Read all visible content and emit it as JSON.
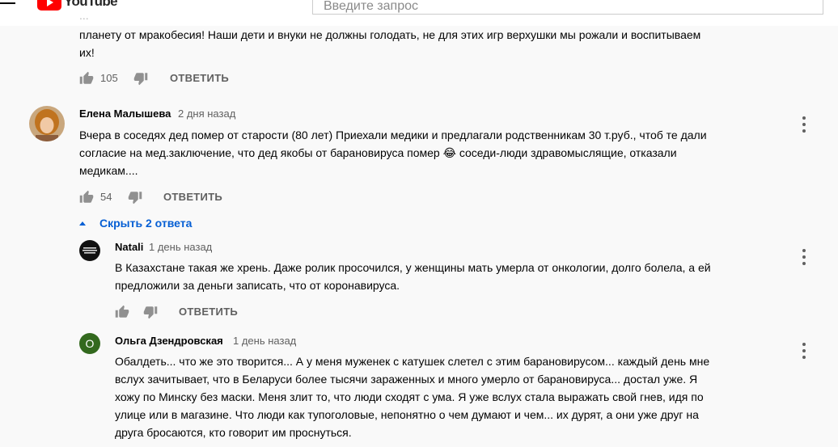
{
  "masthead": {
    "logo_text": "YouTube",
    "search_placeholder": "Введите запрос"
  },
  "colors": {
    "accent": "#065fd4",
    "secondary_text": "#606060",
    "logo_red": "#ff0000",
    "letter_avatar_bg": "#33691e"
  },
  "top_comment": {
    "hidden_line": "...",
    "text_lines": [
      "планету от мракобесия!  Наши дети и внуки не должны голодать, не для этих игр верхушки мы рожали и воспитываем",
      "их!"
    ],
    "like_count": "105",
    "reply_label": "ОТВЕТИТЬ"
  },
  "comment": {
    "author": "Елена Малышева",
    "date": "2 дня назад",
    "text_lines": [
      "Вчера в соседях дед помер от старости (80 лет) Приехали медики и предлагали родственникам 30 т.руб., чтоб те  дали",
      "согласие на мед.заключение, что дед якобы от барановируса помер 😂 соседи-люди здравомыслящие, отказали",
      "медикам...."
    ],
    "like_count": "54",
    "reply_label": "ОТВЕТИТЬ",
    "hide_replies_label": "Скрыть 2 ответа"
  },
  "replies": [
    {
      "author": "Natali",
      "date": "1 день назад",
      "text_lines": [
        "В Казахстане такая же хрень. Даже ролик просочился, у женщины мать умерла от онкологии, долго болела, а ей",
        "предложили за деньги записать, что от коронавируса."
      ],
      "reply_label": "ОТВЕТИТЬ"
    },
    {
      "author": "Ольга Дзендровская",
      "date": "1 день назад",
      "avatar_letter": "О",
      "text_lines": [
        "Обалдеть... что же это творится... А у меня муженек с катушек слетел с этим барановирусом... каждый день мне",
        "вслух зачитывает, что в Беларуси более тысячи зараженных и много умерло от барановируса... достал уже. Я",
        "хожу по Минску без маски. Меня злит то, что люди сходят с ума. Я уже вслух стала выражать свой гнев, идя по",
        "улице или в магазине. Что люди как тупоголовые, непонятно о чем думают и чем... их дурят, а они уже друг на",
        "друга бросаются, кто говорит им проснуться."
      ]
    }
  ]
}
